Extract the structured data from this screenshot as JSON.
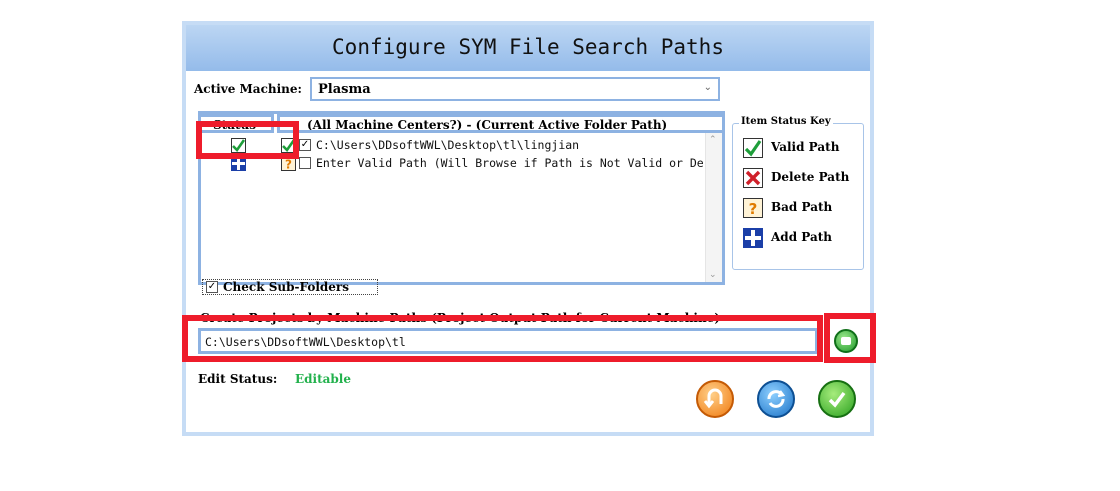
{
  "window": {
    "title": "Configure SYM File Search Paths"
  },
  "machine": {
    "label": "Active Machine:",
    "value": "Plasma"
  },
  "table": {
    "headers": {
      "status": "Status",
      "path": "(All Machine Centers?) - (Current Active Folder Path)"
    },
    "rows": [
      {
        "status_icon": "valid-path-icon",
        "row_icon": "valid-path-icon",
        "checked": true,
        "path": "C:\\Users\\DDsoftWWL\\Desktop\\tl\\lingjian"
      },
      {
        "status_icon": "add-path-icon",
        "row_icon": "bad-path-icon",
        "checked": false,
        "path": "Enter Valid Path (Will Browse if Path is Not Valid or De"
      }
    ]
  },
  "status_key": {
    "title": "Item Status Key",
    "items": [
      {
        "icon": "valid-path-icon",
        "label": "Valid Path"
      },
      {
        "icon": "delete-path-icon",
        "label": "Delete Path"
      },
      {
        "icon": "bad-path-icon",
        "label": "Bad Path"
      },
      {
        "icon": "add-path-icon",
        "label": "Add Path"
      }
    ]
  },
  "subfolders": {
    "label": "Check Sub-Folders",
    "checked": true
  },
  "output": {
    "label": "Create Projects by Machine Paths (Project Output Path for Current Machine)",
    "value": "C:\\Users\\DDsoftWWL\\Desktop\\tl"
  },
  "edit_status": {
    "label": "Edit Status:",
    "value": "Editable",
    "color": "#22b14c"
  },
  "colors": {
    "accent_border": "#8db2e2",
    "highlight": "#ee1c2b"
  }
}
